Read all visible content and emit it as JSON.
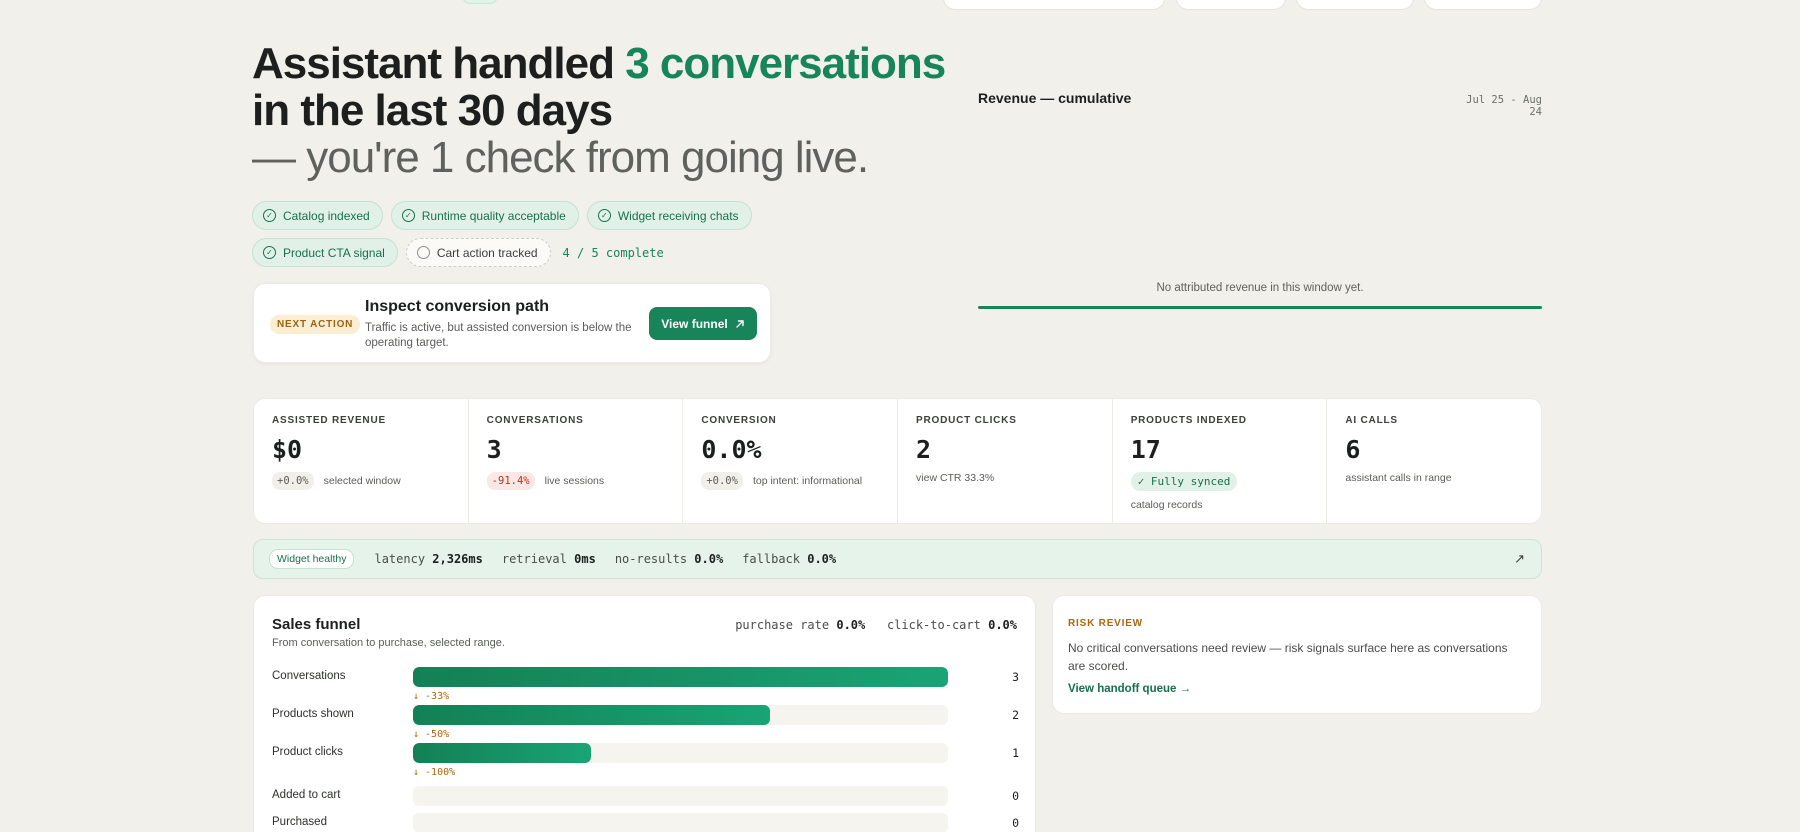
{
  "hero": {
    "title_prefix": "Assistant handled ",
    "title_accent": "3 conversations",
    "title_line2": "in the last 30 days",
    "subtitle": "— you're 1 check from going live."
  },
  "checklist": {
    "items": [
      {
        "label": "Catalog indexed",
        "done": true
      },
      {
        "label": "Runtime quality acceptable",
        "done": true
      },
      {
        "label": "Widget receiving chats",
        "done": true
      },
      {
        "label": "Product CTA signal",
        "done": true
      },
      {
        "label": "Cart action tracked",
        "done": false
      }
    ],
    "progress": "4 / 5 complete"
  },
  "next_action": {
    "badge": "NEXT ACTION",
    "title": "Inspect conversion path",
    "description": "Traffic is active, but assisted conversion is below the operating target.",
    "button_label": "View funnel",
    "button_icon": "arrow-up-right-icon"
  },
  "revenue": {
    "title": "Revenue — cumulative",
    "range": "Jul 25 - Aug 24",
    "empty_message": "No attributed revenue in this window yet."
  },
  "metrics": [
    {
      "label": "ASSISTED REVENUE",
      "value": "$0",
      "delta": "+0.0%",
      "delta_type": "neutral",
      "note": "selected window"
    },
    {
      "label": "CONVERSATIONS",
      "value": "3",
      "delta": "-91.4%",
      "delta_type": "neg",
      "note": "live sessions"
    },
    {
      "label": "CONVERSION",
      "value": "0.0%",
      "delta": "+0.0%",
      "delta_type": "neutral",
      "note": "top intent: informational"
    },
    {
      "label": "PRODUCT CLICKS",
      "value": "2",
      "note": "view CTR 33.3%"
    },
    {
      "label": "PRODUCTS INDEXED",
      "value": "17",
      "badge": "✓ Fully synced",
      "note": "catalog records"
    },
    {
      "label": "AI CALLS",
      "value": "6",
      "note": "assistant calls in range"
    }
  ],
  "health": {
    "badge": "Widget healthy",
    "items": [
      {
        "label": "latency",
        "value": "2,326ms"
      },
      {
        "label": "retrieval",
        "value": "0ms"
      },
      {
        "label": "no-results",
        "value": "0.0%"
      },
      {
        "label": "fallback",
        "value": "0.0%"
      }
    ],
    "arrow": "↗"
  },
  "funnel": {
    "title": "Sales funnel",
    "description": "From conversation to purchase, selected range.",
    "purchase_rate_label": "purchase rate",
    "purchase_rate": "0.0%",
    "ctc_label": "click-to-cart",
    "ctc": "0.0%",
    "max": 3,
    "stages": [
      {
        "label": "Conversations",
        "count": 3,
        "drop": "↓ -33%"
      },
      {
        "label": "Products shown",
        "count": 2,
        "drop": "↓ -50%"
      },
      {
        "label": "Product clicks",
        "count": 1,
        "drop": "↓ -100%"
      },
      {
        "label": "Added to cart",
        "count": 0,
        "drop": ""
      },
      {
        "label": "Purchased",
        "count": 0,
        "drop": ""
      }
    ]
  },
  "risk": {
    "label": "RISK REVIEW",
    "text": "No critical conversations need review — risk signals surface here as conversations are scored.",
    "link": "View handoff queue →"
  },
  "colors": {
    "accent": "#17845a",
    "warning": "#a8680f",
    "negative": "#b53224",
    "background": "#f1f0eb"
  }
}
